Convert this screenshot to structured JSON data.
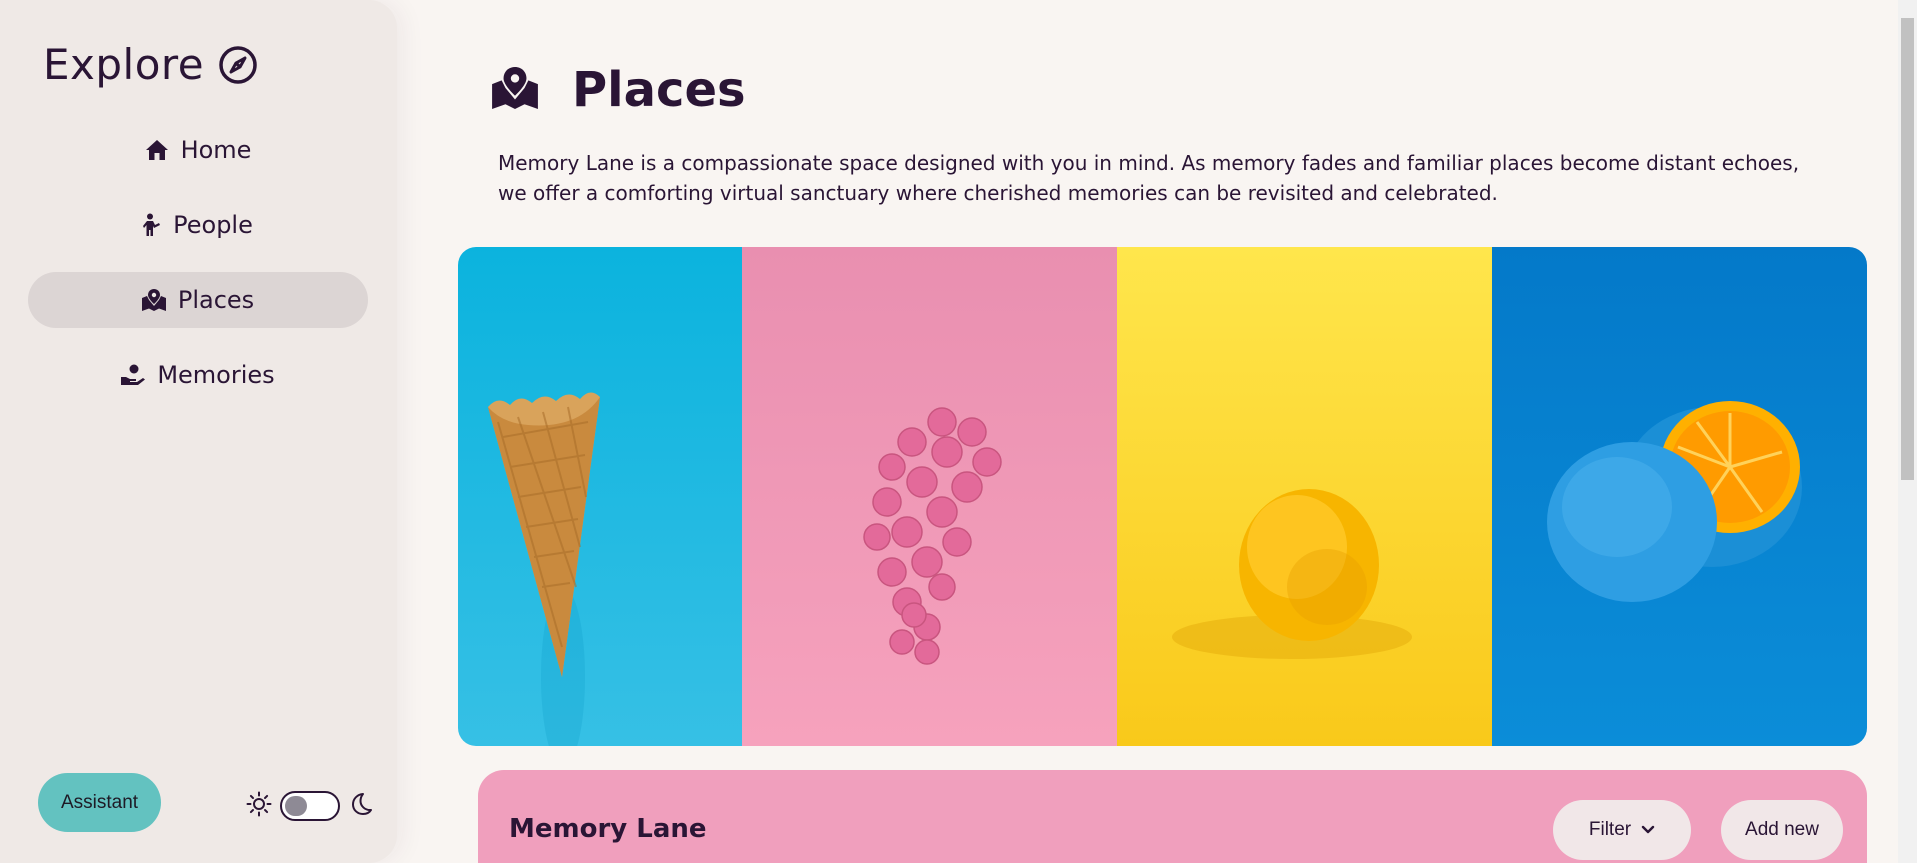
{
  "sidebar": {
    "brand_title": "Explore",
    "brand_icon": "compass-icon",
    "items": [
      {
        "label": "Home",
        "icon": "home-icon",
        "active": false
      },
      {
        "label": "People",
        "icon": "person-icon",
        "active": false
      },
      {
        "label": "Places",
        "icon": "map-location-icon",
        "active": true
      },
      {
        "label": "Memories",
        "icon": "hand-holding-heart-icon",
        "active": false
      }
    ],
    "assistant_label": "Assistant",
    "theme_toggle": {
      "light_icon": "sun-icon",
      "dark_icon": "moon-icon",
      "dark_mode": false
    }
  },
  "main": {
    "title": "Places",
    "title_icon": "map-location-icon",
    "description": "Memory Lane is a compassionate space designed with you in mind. As memory fades and familiar places become distant echoes, we offer a comforting virtual sanctuary where cherished memories can be revisited and celebrated.",
    "gallery": [
      {
        "subject": "ice-cream-cone",
        "background": "#0bb3de"
      },
      {
        "subject": "pink-grapes",
        "background": "#f09ab8"
      },
      {
        "subject": "lemon",
        "background": "#fcd635"
      },
      {
        "subject": "blue-orange",
        "background": "#0680cf"
      }
    ],
    "memory_lane": {
      "title": "Memory Lane",
      "filter_label": "Filter",
      "filter_icon": "chevron-down-icon",
      "add_label": "Add new"
    }
  },
  "colors": {
    "page_bg": "#f9f5f2",
    "sidebar_bg": "#efe9e6",
    "active_nav_bg": "#dcd5d4",
    "text": "#2a1535",
    "assistant_bg": "#63c2c0",
    "memory_card_bg": "#f09fbd"
  }
}
